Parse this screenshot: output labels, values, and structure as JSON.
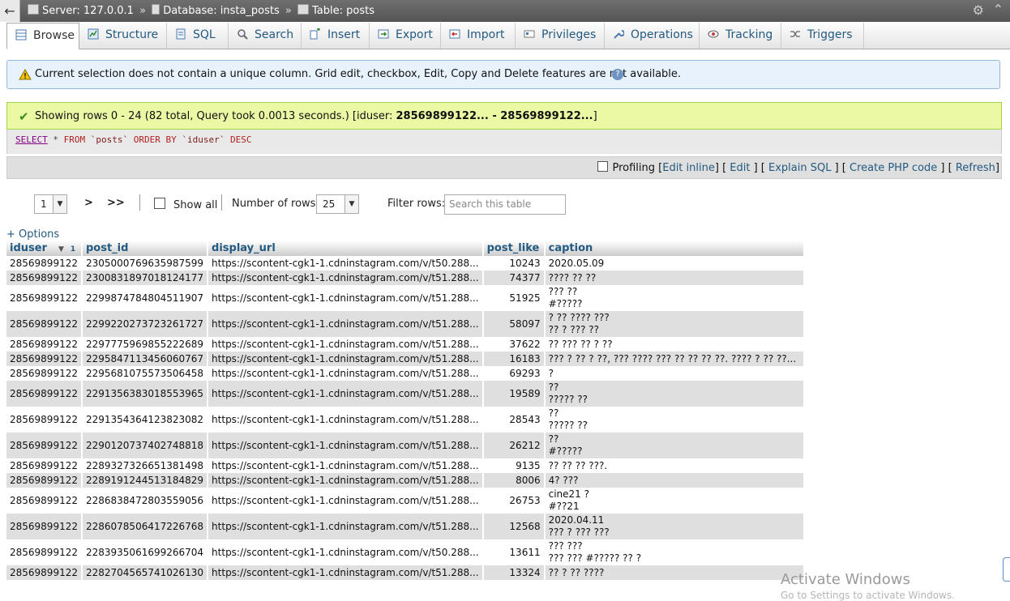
{
  "breadcrumb": {
    "back": "←",
    "server": "Server: 127.0.0.1",
    "database": "Database: insta_posts",
    "table": "Table: posts",
    "sep": "»"
  },
  "tabs": [
    {
      "label": "Browse",
      "icon": "table-icon"
    },
    {
      "label": "Structure",
      "icon": "structure-icon"
    },
    {
      "label": "SQL",
      "icon": "sql-icon"
    },
    {
      "label": "Search",
      "icon": "search-icon"
    },
    {
      "label": "Insert",
      "icon": "insert-icon"
    },
    {
      "label": "Export",
      "icon": "export-icon"
    },
    {
      "label": "Import",
      "icon": "import-icon"
    },
    {
      "label": "Privileges",
      "icon": "privileges-icon"
    },
    {
      "label": "Operations",
      "icon": "wrench-icon"
    },
    {
      "label": "Tracking",
      "icon": "eye-icon"
    },
    {
      "label": "Triggers",
      "icon": "triggers-icon"
    }
  ],
  "notice": {
    "text": "Current selection does not contain a unique column. Grid edit, checkbox, Edit, Copy and Delete features are not available.",
    "help": "?"
  },
  "success": {
    "prefix": "Showing rows 0 - 24 (82 total, Query took 0.0013 seconds.) [iduser: ",
    "range": "28569899122... - 28569899122...",
    "suffix": "]"
  },
  "sql": {
    "select": "SELECT",
    "star": " * ",
    "from": "FROM",
    "table": " `posts` ",
    "order": "ORDER BY",
    "col": " `iduser` ",
    "desc": "DESC"
  },
  "tools": {
    "profiling": "Profiling",
    "edit_inline": "Edit inline",
    "edit": "Edit",
    "explain": "Explain SQL",
    "php": "Create PHP code",
    "refresh": "Refresh"
  },
  "nav": {
    "page": "1",
    "next": ">",
    "last": ">>",
    "show_all": "Show all",
    "rows_label": "Number of rows:",
    "rows_value": "25",
    "filter_label": "Filter rows:",
    "filter_placeholder": "Search this table"
  },
  "options": "+ Options",
  "columns": [
    "iduser",
    "post_id",
    "display_url",
    "post_like",
    "caption"
  ],
  "sort_index": "1",
  "rows": [
    {
      "iduser": "28569899122",
      "post_id": "2305000769635987599",
      "url": "https://scontent-cgk1-1.cdninstagram.com/v/t50.288...",
      "like": "10243",
      "caption": "2020.05.09"
    },
    {
      "iduser": "28569899122",
      "post_id": "2300831897018124177",
      "url": "https://scontent-cgk1-1.cdninstagram.com/v/t51.288...",
      "like": "74377",
      "caption": "???? ?? ??"
    },
    {
      "iduser": "28569899122",
      "post_id": "2299874784804511907",
      "url": "https://scontent-cgk1-1.cdninstagram.com/v/t51.288...",
      "like": "51925",
      "caption": "??? ??\n#?????"
    },
    {
      "iduser": "28569899122",
      "post_id": "2299220273723261727",
      "url": "https://scontent-cgk1-1.cdninstagram.com/v/t51.288...",
      "like": "58097",
      "caption": "? ?? ???? ???\n?? ? ??? ??"
    },
    {
      "iduser": "28569899122",
      "post_id": "2297775969855222689",
      "url": "https://scontent-cgk1-1.cdninstagram.com/v/t51.288...",
      "like": "37622",
      "caption": "?? ??? ?? ? ??"
    },
    {
      "iduser": "28569899122",
      "post_id": "2295847113456060767",
      "url": "https://scontent-cgk1-1.cdninstagram.com/v/t51.288...",
      "like": "16183",
      "caption": "??? ? ?? ? ??, ??? ???? ??? ?? ?? ?? ??. ???? ? ?? ??..."
    },
    {
      "iduser": "28569899122",
      "post_id": "2295681075573506458",
      "url": "https://scontent-cgk1-1.cdninstagram.com/v/t51.288...",
      "like": "69293",
      "caption": "?"
    },
    {
      "iduser": "28569899122",
      "post_id": "2291356383018553965",
      "url": "https://scontent-cgk1-1.cdninstagram.com/v/t51.288...",
      "like": "19589",
      "caption": "??\n????? ??"
    },
    {
      "iduser": "28569899122",
      "post_id": "2291354364123823082",
      "url": "https://scontent-cgk1-1.cdninstagram.com/v/t51.288...",
      "like": "28543",
      "caption": "??\n????? ??"
    },
    {
      "iduser": "28569899122",
      "post_id": "2290120737402748818",
      "url": "https://scontent-cgk1-1.cdninstagram.com/v/t51.288...",
      "like": "26212",
      "caption": "??\n#?????"
    },
    {
      "iduser": "28569899122",
      "post_id": "2289327326651381498",
      "url": "https://scontent-cgk1-1.cdninstagram.com/v/t51.288...",
      "like": "9135",
      "caption": "?? ?? ?? ???."
    },
    {
      "iduser": "28569899122",
      "post_id": "2289191244513184829",
      "url": "https://scontent-cgk1-1.cdninstagram.com/v/t51.288...",
      "like": "8006",
      "caption": "4? ???"
    },
    {
      "iduser": "28569899122",
      "post_id": "2286838472803559056",
      "url": "https://scontent-cgk1-1.cdninstagram.com/v/t51.288...",
      "like": "26753",
      "caption": "cine21 ?\n#??21"
    },
    {
      "iduser": "28569899122",
      "post_id": "2286078506417226768",
      "url": "https://scontent-cgk1-1.cdninstagram.com/v/t51.288...",
      "like": "12568",
      "caption": "2020.04.11\n??? ? ??? ???"
    },
    {
      "iduser": "28569899122",
      "post_id": "2283935061699266704",
      "url": "https://scontent-cgk1-1.cdninstagram.com/v/t50.288...",
      "like": "13611",
      "caption": "??? ???\n??? ??? #????? ?? ?"
    },
    {
      "iduser": "28569899122",
      "post_id": "2282704565741026130",
      "url": "https://scontent-cgk1-1.cdninstagram.com/v/t51.288...",
      "like": "13324",
      "caption": "?? ? ?? ????"
    }
  ],
  "watermark": {
    "title": "Activate Windows",
    "sub": "Go to Settings to activate Windows."
  },
  "colors": {
    "accent": "#235a81",
    "success_bg": "#ebf8a4",
    "notice_bg": "#e7f2fd"
  }
}
